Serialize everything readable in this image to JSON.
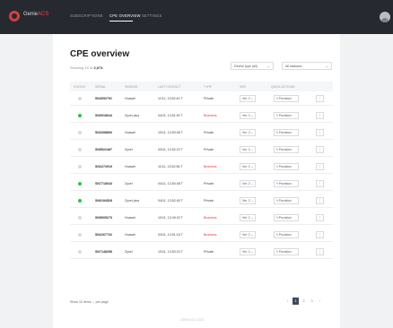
{
  "brand": {
    "name_prefix": "Genie",
    "name_suffix": "ACS",
    "accent": "#d3403a"
  },
  "nav": {
    "items": [
      {
        "label": "SUBSCRIPTIONS"
      },
      {
        "label": "CPE OVERVIEW",
        "active": true
      },
      {
        "label": "SETTINGS"
      }
    ]
  },
  "page": {
    "title": "CPE overview",
    "subtitle_prefix": "Showing 10 of",
    "subtitle_count": "2,074",
    "filters": [
      {
        "value": "Device type (all)"
      },
      {
        "value": "All statuses"
      }
    ]
  },
  "table": {
    "columns": [
      "Status",
      "Serial",
      "Vendor",
      "Last contact",
      "Type",
      "Ver",
      "Quick actions",
      ""
    ],
    "rows": [
      {
        "online": false,
        "serial": "SN4052791",
        "vendor": "Huawei",
        "contact": "11/11, 13:52:40 T",
        "type": "Private",
        "type_red": false,
        "version": "Ver. 2",
        "action": "Provision",
        "more": "⋮"
      },
      {
        "online": true,
        "serial": "SN0918044",
        "vendor": "Zyxel plus",
        "contact": "04/11, 13:51:52 T",
        "type": "Business",
        "type_red": true,
        "version": "Ver. 2",
        "action": "Provision",
        "more": "⋮"
      },
      {
        "online": false,
        "serial": "SN3398806",
        "vendor": "Huawei",
        "contact": "10/11, 13:53:08 T",
        "type": "Private",
        "type_red": false,
        "version": "Ver. 2",
        "action": "Provision",
        "more": "⋮"
      },
      {
        "online": false,
        "serial": "SN5522487",
        "vendor": "Zyxel",
        "contact": "03/11, 13:52:22 T",
        "type": "Private",
        "type_red": false,
        "version": "Ver. 2",
        "action": "Provision",
        "more": "⋮"
      },
      {
        "online": false,
        "serial": "SN2272919",
        "vendor": "Huawei",
        "contact": "11/11, 13:52:56 T",
        "type": "Business",
        "type_red": true,
        "version": "Ver. 2",
        "action": "Provision",
        "more": "⋮"
      },
      {
        "online": true,
        "serial": "SN7718043",
        "vendor": "Zyxel",
        "contact": "04/11, 13:50:48 T",
        "type": "Private",
        "type_red": false,
        "version": "Ver. 2",
        "action": "Provision",
        "more": "⋮"
      },
      {
        "online": true,
        "serial": "SN0194528",
        "vendor": "Zyxel plus",
        "contact": "04/11, 13:52:40 T",
        "type": "Private",
        "type_red": false,
        "version": "Ver. 2",
        "action": "Provision",
        "more": "⋮"
      },
      {
        "online": false,
        "serial": "SN9605273",
        "vendor": "Huawei",
        "contact": "10/11, 13:49:32 T",
        "type": "Business",
        "type_red": true,
        "version": "Ver. 2",
        "action": "Provision",
        "more": "⋮"
      },
      {
        "online": false,
        "serial": "SN2267732",
        "vendor": "Huawei",
        "contact": "03/11, 13:51:16 T",
        "type": "Business",
        "type_red": true,
        "version": "Ver. 2",
        "action": "Provision",
        "more": "⋮"
      },
      {
        "online": false,
        "serial": "SN7148258",
        "vendor": "Zyxel",
        "contact": "10/11, 13:53:24 T",
        "type": "Private",
        "type_red": false,
        "version": "Ver. 2",
        "action": "Provision",
        "more": "⋮"
      }
    ]
  },
  "footer": {
    "show_label": "Show",
    "per_page": "10 items",
    "per_page_suffix": "per page",
    "pages": [
      "‹",
      "1",
      "2",
      "3",
      "›"
    ],
    "active_page": "1"
  },
  "bottom_note": "GENIEACS 2023",
  "colors": {
    "online": "#27c44a",
    "offline": "#d7d9dc",
    "alert": "#e03b33"
  }
}
